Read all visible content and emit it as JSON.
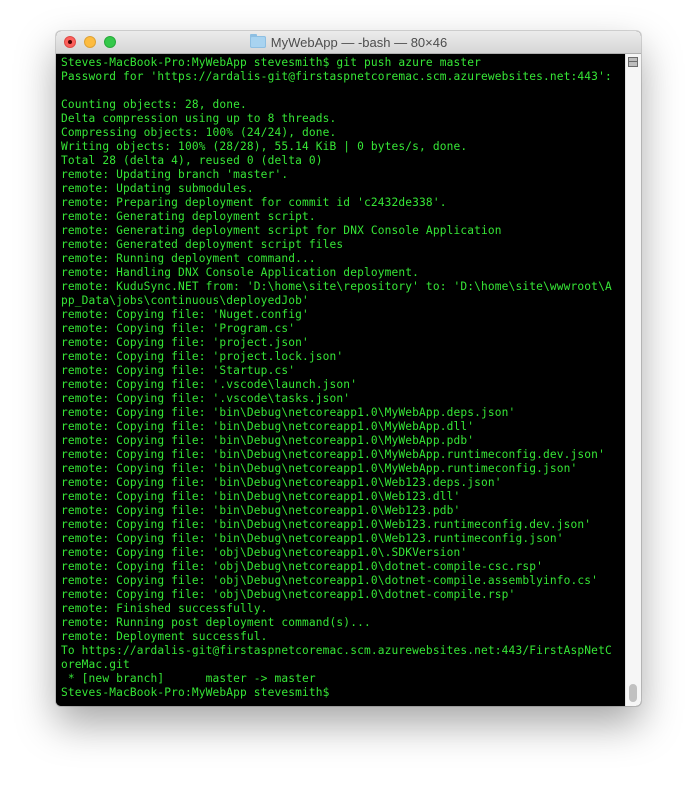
{
  "window": {
    "title": "MyWebApp — -bash — 80×46",
    "folder_icon": "folder-icon",
    "traffic_lights": [
      "close",
      "minimize",
      "maximize"
    ]
  },
  "terminal": {
    "text_color": "#36e636",
    "background": "#000000",
    "lines": [
      "Steves-MacBook-Pro:MyWebApp stevesmith$ git push azure master",
      "Password for 'https://ardalis-git@firstaspnetcoremac.scm.azurewebsites.net:443':",
      "",
      "Counting objects: 28, done.",
      "Delta compression using up to 8 threads.",
      "Compressing objects: 100% (24/24), done.",
      "Writing objects: 100% (28/28), 55.14 KiB | 0 bytes/s, done.",
      "Total 28 (delta 4), reused 0 (delta 0)",
      "remote: Updating branch 'master'.",
      "remote: Updating submodules.",
      "remote: Preparing deployment for commit id 'c2432de338'.",
      "remote: Generating deployment script.",
      "remote: Generating deployment script for DNX Console Application",
      "remote: Generated deployment script files",
      "remote: Running deployment command...",
      "remote: Handling DNX Console Application deployment.",
      "remote: KuduSync.NET from: 'D:\\home\\site\\repository' to: 'D:\\home\\site\\wwwroot\\A",
      "pp_Data\\jobs\\continuous\\deployedJob'",
      "remote: Copying file: 'Nuget.config'",
      "remote: Copying file: 'Program.cs'",
      "remote: Copying file: 'project.json'",
      "remote: Copying file: 'project.lock.json'",
      "remote: Copying file: 'Startup.cs'",
      "remote: Copying file: '.vscode\\launch.json'",
      "remote: Copying file: '.vscode\\tasks.json'",
      "remote: Copying file: 'bin\\Debug\\netcoreapp1.0\\MyWebApp.deps.json'",
      "remote: Copying file: 'bin\\Debug\\netcoreapp1.0\\MyWebApp.dll'",
      "remote: Copying file: 'bin\\Debug\\netcoreapp1.0\\MyWebApp.pdb'",
      "remote: Copying file: 'bin\\Debug\\netcoreapp1.0\\MyWebApp.runtimeconfig.dev.json'",
      "remote: Copying file: 'bin\\Debug\\netcoreapp1.0\\MyWebApp.runtimeconfig.json'",
      "remote: Copying file: 'bin\\Debug\\netcoreapp1.0\\Web123.deps.json'",
      "remote: Copying file: 'bin\\Debug\\netcoreapp1.0\\Web123.dll'",
      "remote: Copying file: 'bin\\Debug\\netcoreapp1.0\\Web123.pdb'",
      "remote: Copying file: 'bin\\Debug\\netcoreapp1.0\\Web123.runtimeconfig.dev.json'",
      "remote: Copying file: 'bin\\Debug\\netcoreapp1.0\\Web123.runtimeconfig.json'",
      "remote: Copying file: 'obj\\Debug\\netcoreapp1.0\\.SDKVersion'",
      "remote: Copying file: 'obj\\Debug\\netcoreapp1.0\\dotnet-compile-csc.rsp'",
      "remote: Copying file: 'obj\\Debug\\netcoreapp1.0\\dotnet-compile.assemblyinfo.cs'",
      "remote: Copying file: 'obj\\Debug\\netcoreapp1.0\\dotnet-compile.rsp'",
      "remote: Finished successfully.",
      "remote: Running post deployment command(s)...",
      "remote: Deployment successful.",
      "To https://ardalis-git@firstaspnetcoremac.scm.azurewebsites.net:443/FirstAspNetC",
      "oreMac.git",
      " * [new branch]      master -> master",
      "Steves-MacBook-Pro:MyWebApp stevesmith$"
    ]
  }
}
